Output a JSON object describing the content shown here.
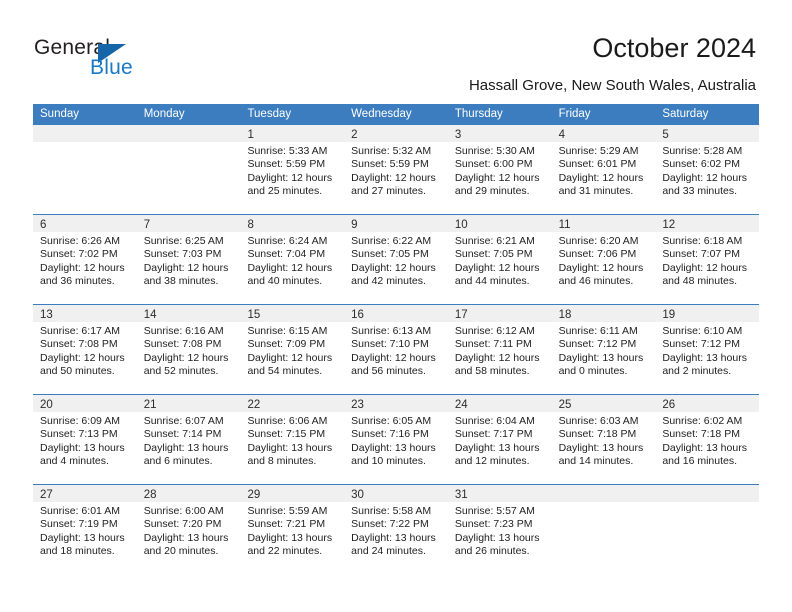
{
  "brand": {
    "name_top": "General",
    "name_bottom": "Blue",
    "color_dark": "#231f20",
    "color_blue": "#1b79c4",
    "triangle_icon": "triangle-icon"
  },
  "header": {
    "title": "October 2024",
    "subtitle": "Hassall Grove, New South Wales, Australia"
  },
  "theme": {
    "header_bg": "#3b7dbf",
    "header_text": "#ffffff",
    "daynum_band_bg": "#f0f0f0",
    "cell_bg": "#ffffff",
    "divider": "#3b7dbf"
  },
  "weekdays": [
    "Sunday",
    "Monday",
    "Tuesday",
    "Wednesday",
    "Thursday",
    "Friday",
    "Saturday"
  ],
  "weeks": [
    [
      {
        "day": "",
        "lines": []
      },
      {
        "day": "",
        "lines": []
      },
      {
        "day": "1",
        "lines": [
          "Sunrise: 5:33 AM",
          "Sunset: 5:59 PM",
          "Daylight: 12 hours",
          "and 25 minutes."
        ]
      },
      {
        "day": "2",
        "lines": [
          "Sunrise: 5:32 AM",
          "Sunset: 5:59 PM",
          "Daylight: 12 hours",
          "and 27 minutes."
        ]
      },
      {
        "day": "3",
        "lines": [
          "Sunrise: 5:30 AM",
          "Sunset: 6:00 PM",
          "Daylight: 12 hours",
          "and 29 minutes."
        ]
      },
      {
        "day": "4",
        "lines": [
          "Sunrise: 5:29 AM",
          "Sunset: 6:01 PM",
          "Daylight: 12 hours",
          "and 31 minutes."
        ]
      },
      {
        "day": "5",
        "lines": [
          "Sunrise: 5:28 AM",
          "Sunset: 6:02 PM",
          "Daylight: 12 hours",
          "and 33 minutes."
        ]
      }
    ],
    [
      {
        "day": "6",
        "lines": [
          "Sunrise: 6:26 AM",
          "Sunset: 7:02 PM",
          "Daylight: 12 hours",
          "and 36 minutes."
        ]
      },
      {
        "day": "7",
        "lines": [
          "Sunrise: 6:25 AM",
          "Sunset: 7:03 PM",
          "Daylight: 12 hours",
          "and 38 minutes."
        ]
      },
      {
        "day": "8",
        "lines": [
          "Sunrise: 6:24 AM",
          "Sunset: 7:04 PM",
          "Daylight: 12 hours",
          "and 40 minutes."
        ]
      },
      {
        "day": "9",
        "lines": [
          "Sunrise: 6:22 AM",
          "Sunset: 7:05 PM",
          "Daylight: 12 hours",
          "and 42 minutes."
        ]
      },
      {
        "day": "10",
        "lines": [
          "Sunrise: 6:21 AM",
          "Sunset: 7:05 PM",
          "Daylight: 12 hours",
          "and 44 minutes."
        ]
      },
      {
        "day": "11",
        "lines": [
          "Sunrise: 6:20 AM",
          "Sunset: 7:06 PM",
          "Daylight: 12 hours",
          "and 46 minutes."
        ]
      },
      {
        "day": "12",
        "lines": [
          "Sunrise: 6:18 AM",
          "Sunset: 7:07 PM",
          "Daylight: 12 hours",
          "and 48 minutes."
        ]
      }
    ],
    [
      {
        "day": "13",
        "lines": [
          "Sunrise: 6:17 AM",
          "Sunset: 7:08 PM",
          "Daylight: 12 hours",
          "and 50 minutes."
        ]
      },
      {
        "day": "14",
        "lines": [
          "Sunrise: 6:16 AM",
          "Sunset: 7:08 PM",
          "Daylight: 12 hours",
          "and 52 minutes."
        ]
      },
      {
        "day": "15",
        "lines": [
          "Sunrise: 6:15 AM",
          "Sunset: 7:09 PM",
          "Daylight: 12 hours",
          "and 54 minutes."
        ]
      },
      {
        "day": "16",
        "lines": [
          "Sunrise: 6:13 AM",
          "Sunset: 7:10 PM",
          "Daylight: 12 hours",
          "and 56 minutes."
        ]
      },
      {
        "day": "17",
        "lines": [
          "Sunrise: 6:12 AM",
          "Sunset: 7:11 PM",
          "Daylight: 12 hours",
          "and 58 minutes."
        ]
      },
      {
        "day": "18",
        "lines": [
          "Sunrise: 6:11 AM",
          "Sunset: 7:12 PM",
          "Daylight: 13 hours",
          "and 0 minutes."
        ]
      },
      {
        "day": "19",
        "lines": [
          "Sunrise: 6:10 AM",
          "Sunset: 7:12 PM",
          "Daylight: 13 hours",
          "and 2 minutes."
        ]
      }
    ],
    [
      {
        "day": "20",
        "lines": [
          "Sunrise: 6:09 AM",
          "Sunset: 7:13 PM",
          "Daylight: 13 hours",
          "and 4 minutes."
        ]
      },
      {
        "day": "21",
        "lines": [
          "Sunrise: 6:07 AM",
          "Sunset: 7:14 PM",
          "Daylight: 13 hours",
          "and 6 minutes."
        ]
      },
      {
        "day": "22",
        "lines": [
          "Sunrise: 6:06 AM",
          "Sunset: 7:15 PM",
          "Daylight: 13 hours",
          "and 8 minutes."
        ]
      },
      {
        "day": "23",
        "lines": [
          "Sunrise: 6:05 AM",
          "Sunset: 7:16 PM",
          "Daylight: 13 hours",
          "and 10 minutes."
        ]
      },
      {
        "day": "24",
        "lines": [
          "Sunrise: 6:04 AM",
          "Sunset: 7:17 PM",
          "Daylight: 13 hours",
          "and 12 minutes."
        ]
      },
      {
        "day": "25",
        "lines": [
          "Sunrise: 6:03 AM",
          "Sunset: 7:18 PM",
          "Daylight: 13 hours",
          "and 14 minutes."
        ]
      },
      {
        "day": "26",
        "lines": [
          "Sunrise: 6:02 AM",
          "Sunset: 7:18 PM",
          "Daylight: 13 hours",
          "and 16 minutes."
        ]
      }
    ],
    [
      {
        "day": "27",
        "lines": [
          "Sunrise: 6:01 AM",
          "Sunset: 7:19 PM",
          "Daylight: 13 hours",
          "and 18 minutes."
        ]
      },
      {
        "day": "28",
        "lines": [
          "Sunrise: 6:00 AM",
          "Sunset: 7:20 PM",
          "Daylight: 13 hours",
          "and 20 minutes."
        ]
      },
      {
        "day": "29",
        "lines": [
          "Sunrise: 5:59 AM",
          "Sunset: 7:21 PM",
          "Daylight: 13 hours",
          "and 22 minutes."
        ]
      },
      {
        "day": "30",
        "lines": [
          "Sunrise: 5:58 AM",
          "Sunset: 7:22 PM",
          "Daylight: 13 hours",
          "and 24 minutes."
        ]
      },
      {
        "day": "31",
        "lines": [
          "Sunrise: 5:57 AM",
          "Sunset: 7:23 PM",
          "Daylight: 13 hours",
          "and 26 minutes."
        ]
      },
      {
        "day": "",
        "lines": []
      },
      {
        "day": "",
        "lines": []
      }
    ]
  ]
}
